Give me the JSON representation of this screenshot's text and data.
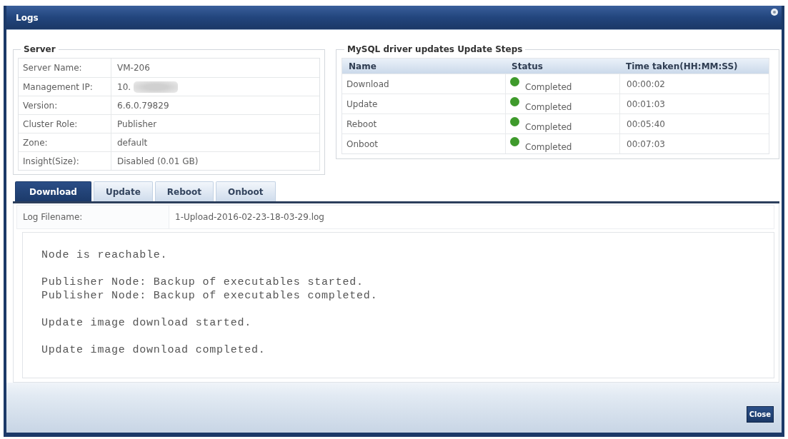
{
  "window": {
    "title": "Logs"
  },
  "server": {
    "legend": "Server",
    "rows": [
      {
        "label": "Server Name:",
        "value": "VM-206",
        "redacted": false
      },
      {
        "label": "Management IP:",
        "value": "10.",
        "redacted": true
      },
      {
        "label": "Version:",
        "value": "6.6.0.79829",
        "redacted": false
      },
      {
        "label": "Cluster Role:",
        "value": "Publisher",
        "redacted": false
      },
      {
        "label": "Zone:",
        "value": "default",
        "redacted": false
      },
      {
        "label": "Insight(Size):",
        "value": "Disabled (0.01 GB)",
        "redacted": false
      }
    ]
  },
  "update_steps": {
    "legend": "MySQL driver updates Update Steps",
    "columns": [
      "Name",
      "Status",
      "Time taken(HH:MM:SS)"
    ],
    "rows": [
      {
        "name": "Download",
        "status": "Completed",
        "color": "#3f9a2c",
        "time": "00:00:02"
      },
      {
        "name": "Update",
        "status": "Completed",
        "color": "#3f9a2c",
        "time": "00:01:03"
      },
      {
        "name": "Reboot",
        "status": "Completed",
        "color": "#3f9a2c",
        "time": "00:05:40"
      },
      {
        "name": "Onboot",
        "status": "Completed",
        "color": "#3f9a2c",
        "time": "00:07:03"
      }
    ]
  },
  "tabs": [
    {
      "label": "Download",
      "selected": true
    },
    {
      "label": "Update",
      "selected": false
    },
    {
      "label": "Reboot",
      "selected": false
    },
    {
      "label": "Onboot",
      "selected": false
    }
  ],
  "log": {
    "filename_label": "Log Filename:",
    "filename": "1-Upload-2016-02-23-18-03-29.log",
    "paragraphs": [
      [
        "Node is reachable."
      ],
      [
        "Publisher Node: Backup of executables started.",
        "Publisher Node: Backup of executables completed."
      ],
      [
        "Update image download started."
      ],
      [
        "Update image download completed."
      ]
    ]
  },
  "buttons": [
    {
      "label": "Close"
    }
  ]
}
